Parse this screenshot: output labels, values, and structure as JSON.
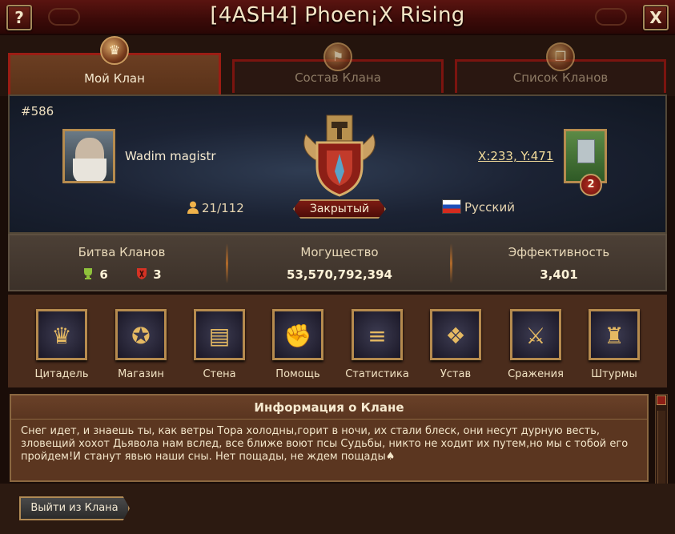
{
  "window": {
    "title": "[4ASH4] Phoen¡X Rising",
    "help_label": "?",
    "close_label": "X"
  },
  "tabs": [
    {
      "label": "Мой Клан",
      "active": true,
      "icon": "crown-icon"
    },
    {
      "label": "Состав Клана",
      "active": false,
      "icon": "banner-icon"
    },
    {
      "label": "Список Кланов",
      "active": false,
      "icon": "book-icon"
    }
  ],
  "clan": {
    "rank": "#586",
    "leader_name": "Wadim magistr",
    "coordinates": "X:233, Y:471",
    "castle_level": "2",
    "members": "21/112",
    "status": "Закрытый",
    "language": "Русский"
  },
  "stats": {
    "battle": {
      "label": "Битва Кланов",
      "wins": "6",
      "losses": "3"
    },
    "power": {
      "label": "Могущество",
      "value": "53,570,792,394"
    },
    "efficiency": {
      "label": "Эффективность",
      "value": "3,401"
    }
  },
  "actions": [
    {
      "label": "Цитадель",
      "icon": "citadel-icon",
      "glyph": "♛"
    },
    {
      "label": "Магазин",
      "icon": "shop-icon",
      "glyph": "✪"
    },
    {
      "label": "Стена",
      "icon": "wall-icon",
      "glyph": "▤"
    },
    {
      "label": "Помощь",
      "icon": "help-fist-icon",
      "glyph": "✊"
    },
    {
      "label": "Статистика",
      "icon": "scroll-icon",
      "glyph": "≡"
    },
    {
      "label": "Устав",
      "icon": "charter-icon",
      "glyph": "❖"
    },
    {
      "label": "Сражения",
      "icon": "axe-icon",
      "glyph": "⚔"
    },
    {
      "label": "Штурмы",
      "icon": "siege-icon",
      "glyph": "♜"
    }
  ],
  "info": {
    "title": "Информация о Клане",
    "text": "Снег идет, и знаешь ты, как ветры Тора холодны,горит в ночи, их стали блеск, они несут дурную весть, зловещий хохот Дьявола нам вслед, все ближе воют псы Судьбы, никто не ходит их путем,но мы с тобой его пройдем!И станут явью наши сны. Нет пощады, не ждем пощады♠"
  },
  "footer": {
    "leave_label": "Выйти из Клана"
  }
}
